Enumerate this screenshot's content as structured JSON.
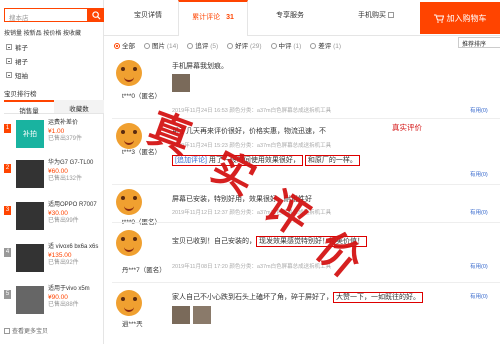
{
  "sidebar": {
    "search_placeholder": "搜本店",
    "sort_links": "按销量 按新品 按价格 按收藏",
    "categories": [
      "裤子",
      "裙子",
      "短袖"
    ],
    "rank_title": "宝贝排行榜",
    "rank_tabs": [
      "销售量",
      "收藏数"
    ],
    "rank_items": [
      {
        "num": "1",
        "text": "运费补差价",
        "price": "¥1.00",
        "sold": "已售出379件"
      },
      {
        "num": "2",
        "text": "华为G7 G7-TL00",
        "price": "¥60.00",
        "sold": "已售出132件"
      },
      {
        "num": "3",
        "text": "适用OPPO R7007",
        "price": "¥30.00",
        "sold": "已售出99件"
      },
      {
        "num": "4",
        "text": "适 vivox6 bx6a x6s",
        "price": "¥135.00",
        "sold": "已售出92件"
      },
      {
        "num": "5",
        "text": "适用于vivo x5m",
        "price": "¥90.00",
        "sold": "已售出88件"
      }
    ],
    "more": "查看更多宝贝"
  },
  "nav": {
    "items": [
      "宝贝详情",
      "累计评论",
      "专享服务"
    ],
    "review_count": "31",
    "mobile": "手机购买",
    "cart": "加入购物车"
  },
  "filter": {
    "options": [
      {
        "label": "全部",
        "count": ""
      },
      {
        "label": "图片",
        "count": "(14)"
      },
      {
        "label": "追评",
        "count": "(5)"
      },
      {
        "label": "好评",
        "count": "(29)"
      },
      {
        "label": "中评",
        "count": "(1)"
      },
      {
        "label": "差评",
        "count": "(1)"
      }
    ],
    "sort": "推荐排序"
  },
  "reviews": [
    {
      "user": "t***0（匿名）",
      "text": "手机屏幕我划痕。",
      "meta": "2019年11月24日 16:53   颜色分类：a37m白色屏幕总成送拆机工具",
      "useful": "有用(0)"
    },
    {
      "user": "t***3（匿名）",
      "text": "用了几天再来评价很好，价格实惠，物流迅速，不",
      "meta": "2019年11月24日 15:23   颜色分类：a37m白色屏幕总成送拆机工具",
      "add_label": "[追加评论]",
      "add_text": "用了一段时间使用效果很好，",
      "add_hl": "和原厂的一样。",
      "useful": "有用(0)"
    },
    {
      "user": "t***0（匿名）",
      "text": "屏幕已安装，特别好用，效果很好，耐用性好",
      "meta": "2019年11月12日 12:37   颜色分类：a37m白色屏幕总成送拆机工具",
      "useful": "有用(0)"
    },
    {
      "user": "丹***7（匿名）",
      "text": "宝贝已收到！自己安装的，",
      "hl": "现发效果感觉特别好！物美价值！",
      "meta": "2019年11月08日 17:20   颜色分类：a37m白色屏幕总成送拆机工具",
      "useful": "有用(0)"
    },
    {
      "user": "逍***兲",
      "text": "家人自己不小心跌到石头上磕坏了角，碎于屏好了，",
      "hl": "大赞一下，一如既往的好。",
      "meta": "2019年11月06日 ...   颜色分类：a37m白色屏幕总成送拆机工具",
      "useful": "有用(0)"
    }
  ],
  "watermark": {
    "chars": [
      "真",
      "实",
      "评",
      "价"
    ],
    "side_label": "真实评价"
  },
  "colors": {
    "accent": "#ff4400",
    "stamp": "#d41515"
  }
}
